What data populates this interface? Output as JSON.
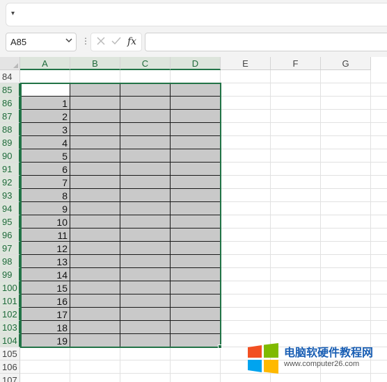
{
  "ribbon": {
    "qat_icon": "customize-quick-access-icon"
  },
  "formula_bar": {
    "name_box": "A85",
    "name_box_icon": "chevron-down-icon",
    "cancel_icon": "x-icon",
    "enter_icon": "check-icon",
    "function_label": "fx",
    "formula_value": ""
  },
  "sheet": {
    "columns": [
      "A",
      "B",
      "C",
      "D",
      "E",
      "F",
      "G"
    ],
    "rows": [
      "84",
      "85",
      "86",
      "87",
      "88",
      "89",
      "90",
      "91",
      "92",
      "93",
      "94",
      "95",
      "96",
      "97",
      "98",
      "99",
      "100",
      "101",
      "102",
      "103",
      "104",
      "105",
      "106",
      "107"
    ],
    "selected_range": "A85:D104",
    "column_a_values": [
      "",
      "1",
      "2",
      "3",
      "4",
      "5",
      "6",
      "7",
      "8",
      "9",
      "10",
      "11",
      "12",
      "13",
      "14",
      "15",
      "16",
      "17",
      "18",
      "19"
    ],
    "fill_color": "#c9c9c9",
    "selection_color": "#217346"
  },
  "watermark": {
    "title": "电脑软硬件教程网",
    "url": "www.computer26.com",
    "logo_colors": [
      "#f25022",
      "#7fba00",
      "#00a4ef",
      "#ffb900"
    ]
  }
}
